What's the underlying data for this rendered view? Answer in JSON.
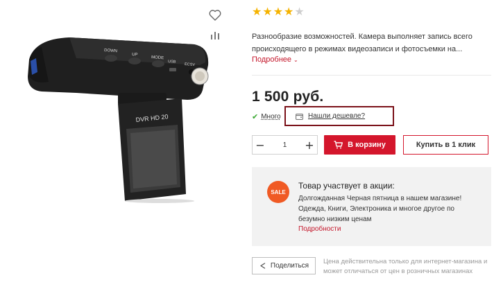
{
  "rating": {
    "filled": 4,
    "total": 5
  },
  "description": "Разнообразие возможностей. Камера выполняет запись всего происходящего в режимах видеозаписи и фотосъемки на...",
  "more_link": "Подробнее",
  "price": "1 500 руб.",
  "stock_label": "Много",
  "cheaper_link": "Нашли дешевле?",
  "quantity": {
    "value": "1",
    "minus": "−",
    "plus": "+"
  },
  "cart_button": "В корзину",
  "buy_one_click": "Купить в 1 клик",
  "promo": {
    "badge": "SALE",
    "title": "Товар участвует в акции:",
    "text": "Долгожданная Черная пятница в нашем магазине! Одежда, Книги, Электроника и многое другое по безумно низким ценам",
    "link": "Подробности"
  },
  "share_button": "Поделиться",
  "disclaimer": "Цена действительна только для интернет-магазина и может отличаться от цен в розничных магазинах",
  "camera_labels": {
    "down": "DOWN",
    "up": "UP",
    "mode": "MODE",
    "usb": "USB",
    "ecsv": "ECSV",
    "model": "DVR HD 20"
  },
  "colors": {
    "accent": "#d4162c",
    "star": "#f5b301",
    "star_empty": "#cfcfcf",
    "sale": "#f05a24",
    "check": "#3aa832",
    "highlight_box": "#7a1018"
  }
}
